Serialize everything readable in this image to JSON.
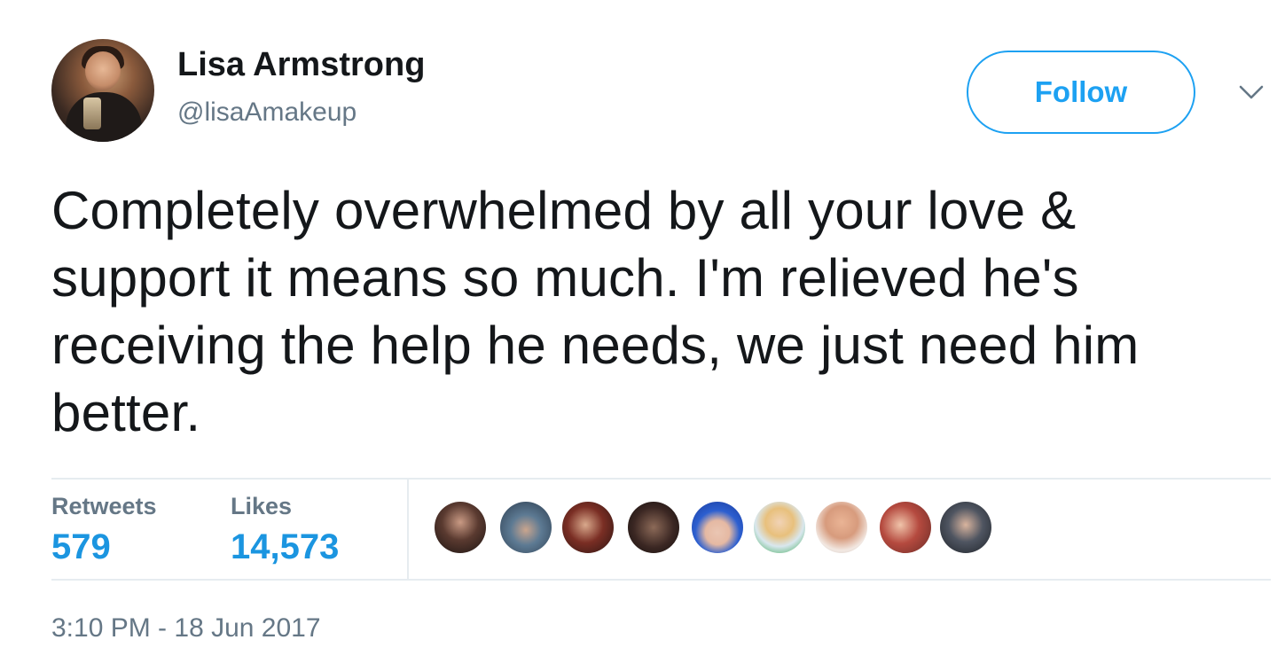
{
  "author": {
    "name": "Lisa Armstrong",
    "handle": "@lisaAmakeup"
  },
  "follow_button": {
    "label": "Follow"
  },
  "tweet": {
    "text": "Completely overwhelmed by all your love & support it means so much. I'm relieved he's receiving the help he needs, we just need him better."
  },
  "stats": {
    "retweets_label": "Retweets",
    "retweets_count": "579",
    "likes_label": "Likes",
    "likes_count": "14,573"
  },
  "likers": [
    {
      "icon": "liker-avatar"
    },
    {
      "icon": "liker-avatar"
    },
    {
      "icon": "liker-avatar"
    },
    {
      "icon": "liker-avatar"
    },
    {
      "icon": "liker-avatar"
    },
    {
      "icon": "liker-avatar"
    },
    {
      "icon": "liker-avatar"
    },
    {
      "icon": "liker-avatar"
    },
    {
      "icon": "liker-avatar"
    }
  ],
  "timestamp": "3:10 PM - 18 Jun 2017",
  "colors": {
    "accent": "#1da1f2",
    "count": "#1b95e0",
    "secondary_text": "#657786",
    "primary_text": "#14171a",
    "divider": "#e6ecf0"
  },
  "icons": {
    "more": "chevron-down-icon"
  }
}
